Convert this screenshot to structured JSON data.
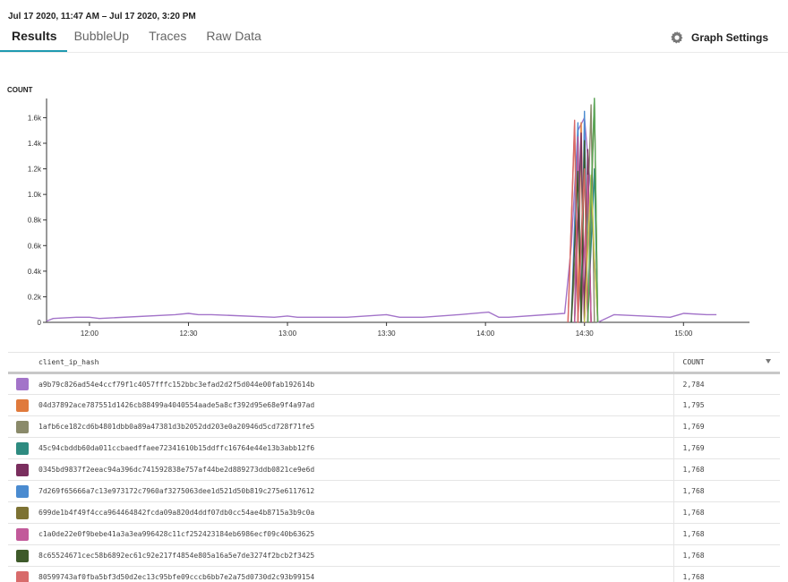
{
  "header": {
    "time_range": "Jul 17 2020, 11:47 AM – Jul 17 2020, 3:20 PM",
    "tabs": [
      {
        "label": "Results",
        "active": true
      },
      {
        "label": "BubbleUp",
        "active": false
      },
      {
        "label": "Traces",
        "active": false
      },
      {
        "label": "Raw Data",
        "active": false
      }
    ],
    "graph_settings_label": "Graph Settings",
    "graph_settings_icon": "gear-icon"
  },
  "chart_data": {
    "type": "line",
    "ylabel": "COUNT",
    "ylim": [
      0,
      1750
    ],
    "yticks": [
      0,
      200,
      400,
      600,
      800,
      1000,
      1200,
      1400,
      1600
    ],
    "ytick_labels": [
      "0",
      "0.2k",
      "0.4k",
      "0.6k",
      "0.8k",
      "1.0k",
      "1.2k",
      "1.4k",
      "1.6k"
    ],
    "x_time_range": [
      "11:47",
      "15:20"
    ],
    "xtick_labels": [
      "12:00",
      "12:30",
      "13:00",
      "13:30",
      "14:00",
      "14:30",
      "15:00"
    ],
    "grid": false,
    "series": [
      {
        "color": "#a374c9",
        "points": [
          [
            "11:47",
            10
          ],
          [
            "11:49",
            30
          ],
          [
            "11:56",
            40
          ],
          [
            "12:00",
            40
          ],
          [
            "12:03",
            30
          ],
          [
            "12:26",
            60
          ],
          [
            "12:30",
            70
          ],
          [
            "12:33",
            60
          ],
          [
            "12:37",
            60
          ],
          [
            "12:56",
            40
          ],
          [
            "13:00",
            50
          ],
          [
            "13:03",
            40
          ],
          [
            "13:18",
            40
          ],
          [
            "13:30",
            60
          ],
          [
            "13:34",
            40
          ],
          [
            "13:41",
            40
          ],
          [
            "13:52",
            60
          ],
          [
            "14:01",
            80
          ],
          [
            "14:04",
            40
          ],
          [
            "14:07",
            40
          ],
          [
            "14:24",
            70
          ],
          [
            "14:26",
            600
          ],
          [
            "14:28",
            1500
          ],
          [
            "14:30",
            1600
          ],
          [
            "14:32",
            1000
          ],
          [
            "14:34",
            0
          ],
          [
            "14:39",
            60
          ],
          [
            "14:56",
            40
          ],
          [
            "15:00",
            70
          ],
          [
            "15:07",
            60
          ],
          [
            "15:10",
            60
          ]
        ]
      },
      {
        "color": "#e07a3c",
        "points": [
          [
            "14:25",
            0
          ],
          [
            "14:27",
            1540
          ],
          [
            "14:28",
            0
          ],
          [
            "14:29",
            1560
          ],
          [
            "14:30",
            0
          ],
          [
            "14:31",
            1100
          ],
          [
            "14:32",
            0
          ]
        ]
      },
      {
        "color": "#8a8a6a",
        "points": [
          [
            "14:26",
            0
          ],
          [
            "14:28",
            800
          ],
          [
            "14:29",
            1350
          ],
          [
            "14:30",
            0
          ],
          [
            "14:32",
            1700
          ],
          [
            "14:33",
            0
          ]
        ]
      },
      {
        "color": "#2e8b80",
        "points": [
          [
            "14:27",
            0
          ],
          [
            "14:28",
            1420
          ],
          [
            "14:29",
            0
          ],
          [
            "14:30",
            1500
          ],
          [
            "14:31",
            0
          ],
          [
            "14:33",
            1200
          ],
          [
            "14:34",
            0
          ]
        ]
      },
      {
        "color": "#7a2e5e",
        "points": [
          [
            "14:27",
            0
          ],
          [
            "14:29",
            1480
          ],
          [
            "14:30",
            0
          ],
          [
            "14:31",
            1350
          ],
          [
            "14:32",
            0
          ]
        ]
      },
      {
        "color": "#4a8bd0",
        "points": [
          [
            "14:26",
            0
          ],
          [
            "14:28",
            1560
          ],
          [
            "14:29",
            0
          ],
          [
            "14:30",
            1650
          ],
          [
            "14:31",
            0
          ]
        ]
      },
      {
        "color": "#7d7233",
        "points": [
          [
            "14:28",
            0
          ],
          [
            "14:30",
            1300
          ],
          [
            "14:31",
            0
          ],
          [
            "14:33",
            1750
          ],
          [
            "14:34",
            0
          ]
        ]
      },
      {
        "color": "#c25a9a",
        "points": [
          [
            "14:27",
            0
          ],
          [
            "14:28",
            1450
          ],
          [
            "14:29",
            0
          ],
          [
            "14:31",
            1150
          ],
          [
            "14:32",
            0
          ]
        ]
      },
      {
        "color": "#3e5a2a",
        "points": [
          [
            "14:26",
            0
          ],
          [
            "14:28",
            1180
          ],
          [
            "14:29",
            0
          ],
          [
            "14:30",
            1420
          ],
          [
            "14:31",
            0
          ]
        ]
      },
      {
        "color": "#d86b6b",
        "points": [
          [
            "14:25",
            0
          ],
          [
            "14:27",
            1580
          ],
          [
            "14:28",
            0
          ],
          [
            "14:30",
            1200
          ],
          [
            "14:31",
            0
          ]
        ]
      },
      {
        "color": "#c9c94a",
        "points": [
          [
            "14:30",
            0
          ],
          [
            "14:32",
            1150
          ],
          [
            "14:33",
            500
          ],
          [
            "14:34",
            0
          ]
        ]
      },
      {
        "color": "#58a858",
        "points": [
          [
            "14:31",
            0
          ],
          [
            "14:32",
            1000
          ],
          [
            "14:33",
            1750
          ],
          [
            "14:34",
            0
          ]
        ]
      }
    ]
  },
  "table": {
    "columns": [
      "",
      "client_ip_hash",
      "COUNT"
    ],
    "rows": [
      {
        "color": "#a374c9",
        "hash": "a9b79c826ad54e4ccf79f1c4057fffc152bbc3efad2d2f5d044e00fab192614b",
        "count": "2,784"
      },
      {
        "color": "#e07a3c",
        "hash": "04d37892ace787551d1426cb88499a4040554aade5a8cf392d95e68e9f4a97ad",
        "count": "1,795"
      },
      {
        "color": "#8a8a6a",
        "hash": "1afb6ce182cd6b4801dbb0a89a47381d3b2052dd203e0a20946d5cd728f71fe5",
        "count": "1,769"
      },
      {
        "color": "#2e8b80",
        "hash": "45c94cbddb60da011ccbaedffaee72341610b15ddffc16764e44e13b3abb12f6",
        "count": "1,769"
      },
      {
        "color": "#7a2e5e",
        "hash": "0345bd9837f2eeac94a396dc741592838e757af44be2d889273ddb0821ce9e6d",
        "count": "1,768"
      },
      {
        "color": "#4a8bd0",
        "hash": "7d269f65666a7c13e973172c7960af3275063dee1d521d50b819c275e6117612",
        "count": "1,768"
      },
      {
        "color": "#7d7233",
        "hash": "699de1b4f49f4cca964464842fcda09a820d4ddf07db0cc54ae4b8715a3b9c0a",
        "count": "1,768"
      },
      {
        "color": "#c25a9a",
        "hash": "c1a0de22e0f9bebe41a3a3ea996428c11cf252423184eb6986ecf09c40b63625",
        "count": "1,768"
      },
      {
        "color": "#3e5a2a",
        "hash": "8c65524671cec58b6892ec61c92e217f4854e805a16a5e7de3274f2bcb2f3425",
        "count": "1,768"
      },
      {
        "color": "#d86b6b",
        "hash": "80599743af0fba5bf3d50d2ec13c95bfe09cccb6bb7e2a75d0730d2c93b99154",
        "count": "1,768"
      }
    ]
  }
}
